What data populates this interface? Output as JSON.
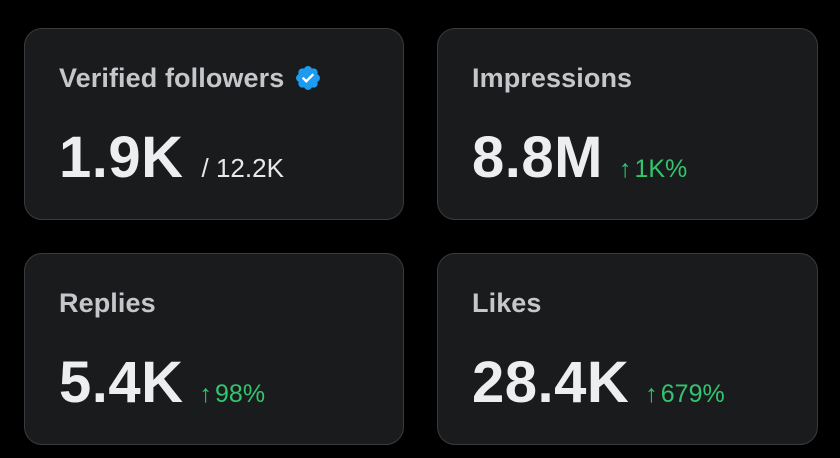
{
  "colors": {
    "background": "#000000",
    "card_background": "#1a1b1d",
    "card_border": "#3a3b3e",
    "label": "#c5c7ca",
    "value": "#eceef0",
    "positive": "#32c46f",
    "verified_badge": "#1d9bf0"
  },
  "cards": [
    {
      "label": "Verified followers",
      "icon": "verified-badge-icon",
      "value": "1.9K",
      "total": "/ 12.2K"
    },
    {
      "label": "Impressions",
      "value": "8.8M",
      "change_arrow": "↑",
      "change": "1K%"
    },
    {
      "label": "Replies",
      "value": "5.4K",
      "change_arrow": "↑",
      "change": "98%"
    },
    {
      "label": "Likes",
      "value": "28.4K",
      "change_arrow": "↑",
      "change": "679%"
    }
  ]
}
